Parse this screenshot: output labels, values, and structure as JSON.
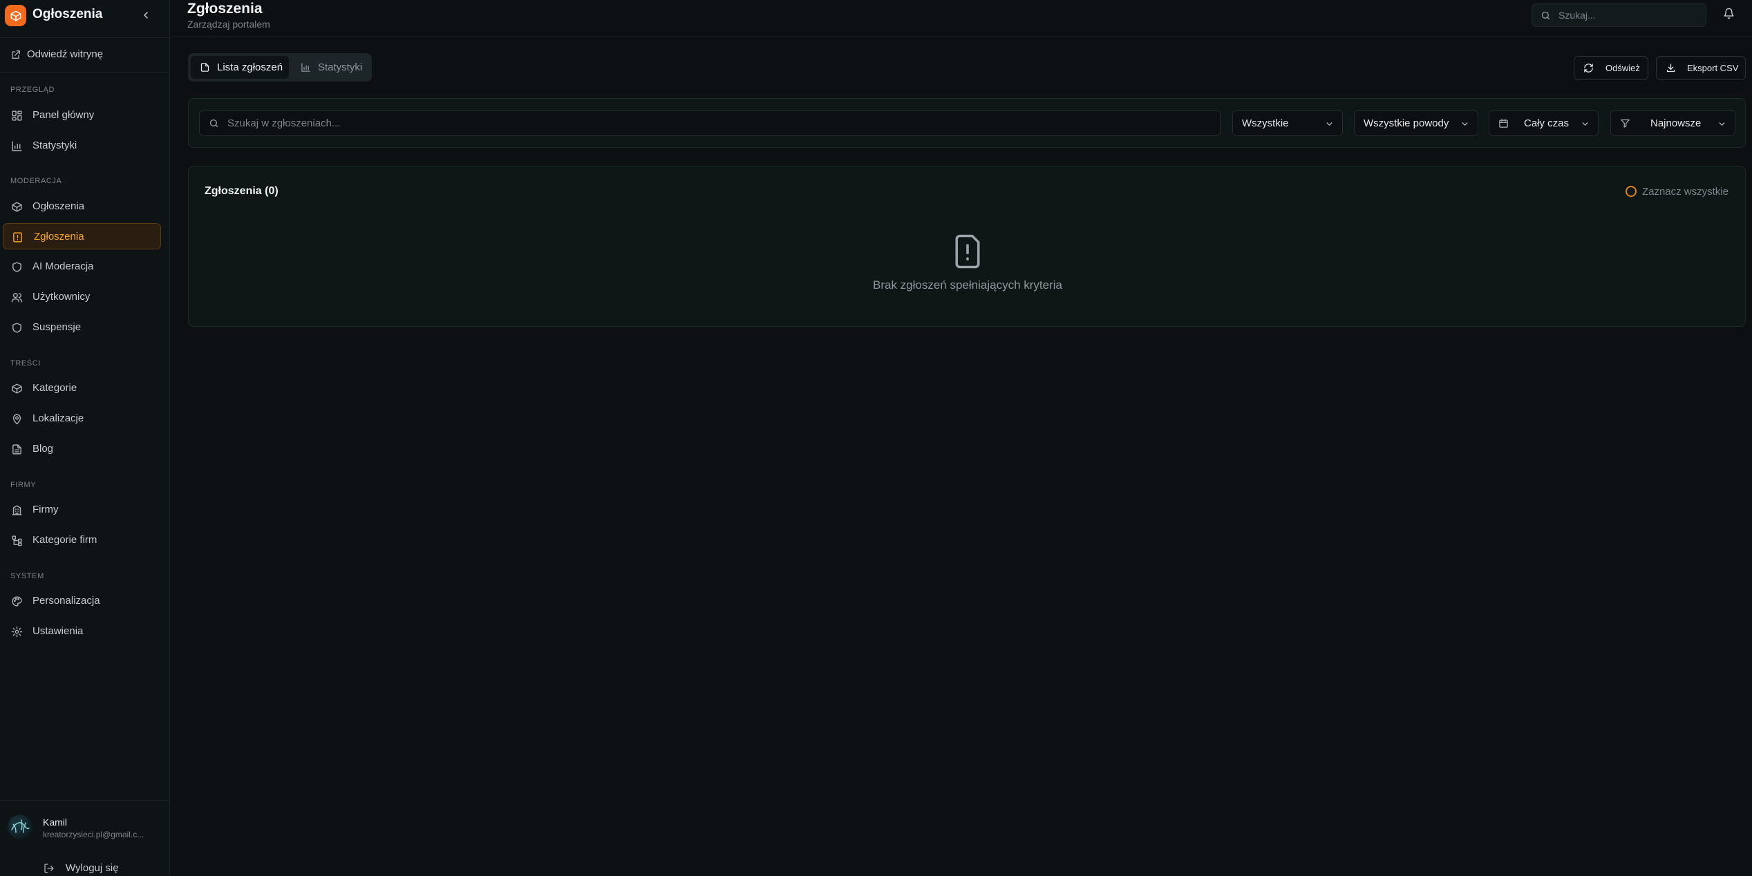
{
  "brand": {
    "name": "Ogłoszenia",
    "logo_color": "#f26a1b"
  },
  "sidebar": {
    "visit_site": "Odwiedź witrynę",
    "sections": {
      "overview": "PRZEGLĄD",
      "moderation": "MODERACJA",
      "content": "TREŚCI",
      "companies": "FIRMY",
      "system": "SYSTEM"
    },
    "items": {
      "dashboard": "Panel główny",
      "statistics": "Statystyki",
      "listings": "Ogłoszenia",
      "reports": "Zgłoszenia",
      "ai_moderation": "AI Moderacja",
      "users": "Użytkownicy",
      "suspensions": "Suspensje",
      "categories": "Kategorie",
      "locations": "Lokalizacje",
      "blog": "Blog",
      "firms": "Firmy",
      "firm_categories": "Kategorie firm",
      "personalization": "Personalizacja",
      "settings": "Ustawienia"
    },
    "active_item": "reports",
    "user": {
      "name": "Kamil",
      "email": "kreatorzysieci.pl@gmail.c..."
    },
    "logout": "Wyloguj się"
  },
  "header": {
    "title": "Zgłoszenia",
    "subtitle": "Zarządzaj portalem",
    "search_placeholder": "Szukaj..."
  },
  "main": {
    "tabs": {
      "list": "Lista zgłoszeń",
      "stats": "Statystyki"
    },
    "active_tab": "list",
    "buttons": {
      "refresh": "Odśwież",
      "export": "Eksport CSV"
    },
    "filters": {
      "search_placeholder": "Szukaj w zgłoszeniach...",
      "status": "Wszystkie",
      "reason": "Wszystkie powody",
      "period": "Cały czas",
      "sort": "Najnowsze"
    },
    "reports": {
      "title": "Zgłoszenia (0)",
      "select_all": "Zaznacz wszystkie",
      "empty_message": "Brak zgłoszeń spełniających kryteria"
    }
  },
  "colors": {
    "accent": "#f5a623",
    "active_bg": "#2a1e10",
    "background": "#0c1012"
  },
  "icons": {
    "brand": "package-icon",
    "visit_site": "external-link-icon",
    "dashboard": "layout-grid-icon",
    "statistics": "bar-chart-icon",
    "listings": "package-icon",
    "reports": "file-warning-icon",
    "ai_moderation": "shield-icon",
    "users": "users-icon",
    "suspensions": "shield-icon",
    "categories": "package-icon",
    "locations": "map-pin-icon",
    "blog": "file-text-icon",
    "firms": "building-icon",
    "firm_categories": "network-icon",
    "personalization": "palette-icon",
    "settings": "gear-icon",
    "logout": "log-out-icon",
    "refresh": "refresh-icon",
    "export": "download-icon",
    "empty_state": "file-warning-icon"
  }
}
